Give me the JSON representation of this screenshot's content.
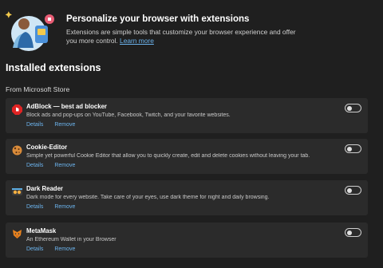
{
  "banner": {
    "title": "Personalize your browser with extensions",
    "description": "Extensions are simple tools that customize your browser experience and offer you more control.",
    "learn_more": "Learn more"
  },
  "section": {
    "title": "Installed extensions",
    "source": "From Microsoft Store"
  },
  "extensions": [
    {
      "name": "AdBlock — best ad blocker",
      "description": "Block ads and pop-ups on YouTube, Facebook, Twitch, and your favorite websites.",
      "details": "Details",
      "remove": "Remove",
      "icon": "adblock-icon",
      "enabled": false
    },
    {
      "name": "Cookie-Editor",
      "description": "Simple yet powerful Cookie Editor that allow you to quickly create, edit and delete cookies without leaving your tab.",
      "details": "Details",
      "remove": "Remove",
      "icon": "cookie-icon",
      "enabled": false
    },
    {
      "name": "Dark Reader",
      "description": "Dark mode for every website. Take care of your eyes, use dark theme for night and daily browsing.",
      "details": "Details",
      "remove": "Remove",
      "icon": "dark-reader-icon",
      "enabled": false
    },
    {
      "name": "MetaMask",
      "description": "An Ethereum Wallet in your Browser",
      "details": "Details",
      "remove": "Remove",
      "icon": "metamask-icon",
      "enabled": false
    }
  ],
  "colors": {
    "background": "#1f1f1f",
    "card": "#2b2b2b",
    "link": "#6cb4ee"
  }
}
